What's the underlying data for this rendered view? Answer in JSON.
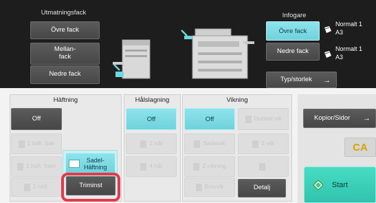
{
  "output_tray": {
    "title": "Utmatningsfack",
    "buttons": [
      "Övre fack",
      "Mellan-\nfack",
      "Nedre fack"
    ]
  },
  "input_tray": {
    "title": "Infogare",
    "upper_label": "Övre fack",
    "lower_label": "Nedre fack",
    "upper_paper": {
      "type": "Normalt 1",
      "size": "A3"
    },
    "lower_paper": {
      "type": "Normalt 1",
      "size": "A3"
    },
    "type_size_button": "Typ/storlek"
  },
  "stapling": {
    "title": "Häftning",
    "off_label": "Off",
    "disabled_left": [
      "1 häft. bak",
      "1 häft. fram",
      "2 häft."
    ],
    "saddle_label": "Sadel-\nHäftning",
    "trim_label": "Triminst"
  },
  "punch": {
    "title": "Hålslagning",
    "off_label": "Off",
    "disabled": [
      "2 hål",
      "4 hål"
    ]
  },
  "folding": {
    "title": "Vikning",
    "off_label": "Off",
    "disabled": [
      "Sadelvik",
      "Z-vikning",
      "Brevvik"
    ],
    "disabled_right": [
      "Dubbel vik",
      "Z-vik"
    ],
    "detail_label": "Detalj"
  },
  "side": {
    "copies_label": "Kopior/Sidor",
    "ca_label": "CA",
    "start_label": "Start"
  },
  "colors": {
    "highlight_red": "#e23a4a",
    "teal": "#7fdde7",
    "start_green": "#3ccfb8"
  },
  "icons": [
    "copier-machine-icon",
    "arrow-right-icon",
    "paper-stack-icon",
    "start-diamond-icon"
  ]
}
